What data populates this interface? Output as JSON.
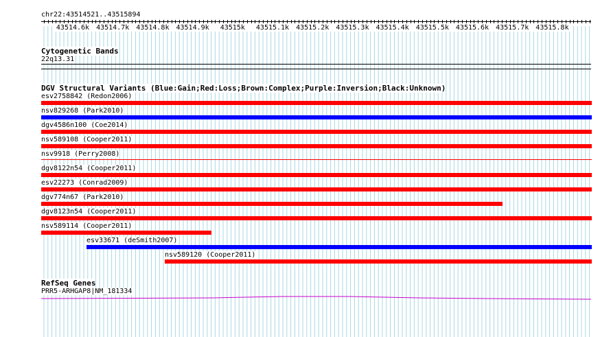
{
  "ruler": {
    "location": "chr22:43514521..43515894",
    "ticks": [
      "43514.6k",
      "43514.7k",
      "43514.8k",
      "43514.9k",
      "43515k",
      "43515.1k",
      "43515.2k",
      "43515.3k",
      "43515.4k",
      "43515.5k",
      "43515.6k",
      "43515.7k",
      "43515.8k"
    ]
  },
  "cytobands": {
    "title": "Cytogenetic Bands",
    "band": "22q13.31"
  },
  "dgv": {
    "title": "DGV Structural Variants (Blue:Gain;Red:Loss;Brown:Complex;Purple:Inversion;Black:Unknown)",
    "variants": [
      {
        "label": "esv2758842 (Redon2006)",
        "type": "loss",
        "color": "#ff0000",
        "start": 0,
        "end": 1
      },
      {
        "label": "nsv829268 (Park2010)",
        "type": "gain",
        "color": "#0000ff",
        "start": 0,
        "end": 1
      },
      {
        "label": "dgv4586n100 (Coe2014)",
        "type": "loss",
        "color": "#ff0000",
        "start": 0,
        "end": 1
      },
      {
        "label": "nsv589108 (Cooper2011)",
        "type": "loss",
        "color": "#ff0000",
        "start": 0,
        "end": 1
      },
      {
        "label": "nsv9918 (Perry2008)",
        "type": "loss",
        "color": "#ff0000",
        "start": 0,
        "end": 1,
        "thin": true
      },
      {
        "label": "dgv8122n54 (Cooper2011)",
        "type": "loss",
        "color": "#ff0000",
        "start": 0,
        "end": 1
      },
      {
        "label": "esv22273 (Conrad2009)",
        "type": "loss",
        "color": "#ff0000",
        "start": 0,
        "end": 1
      },
      {
        "label": "dgv774n67 (Park2010)",
        "type": "loss",
        "color": "#ff0000",
        "start": 0,
        "end": 0.838
      },
      {
        "label": "dgv8123n54 (Cooper2011)",
        "type": "loss",
        "color": "#ff0000",
        "start": 0,
        "end": 1
      },
      {
        "label": "nsv589114 (Cooper2011)",
        "type": "loss",
        "color": "#ff0000",
        "start": 0,
        "end": 0.309
      },
      {
        "label": "esv33671 (deSmith2007)",
        "type": "gain",
        "color": "#0000ff",
        "start": 0.082,
        "end": 1
      },
      {
        "label": "nsv589120 (Cooper2011)",
        "type": "loss",
        "color": "#ff0000",
        "start": 0.224,
        "end": 1
      }
    ]
  },
  "refseq": {
    "title": "RefSeq Genes",
    "gene": "PRR5-ARHGAP8|NM_181334",
    "color": "#cc00cc"
  }
}
